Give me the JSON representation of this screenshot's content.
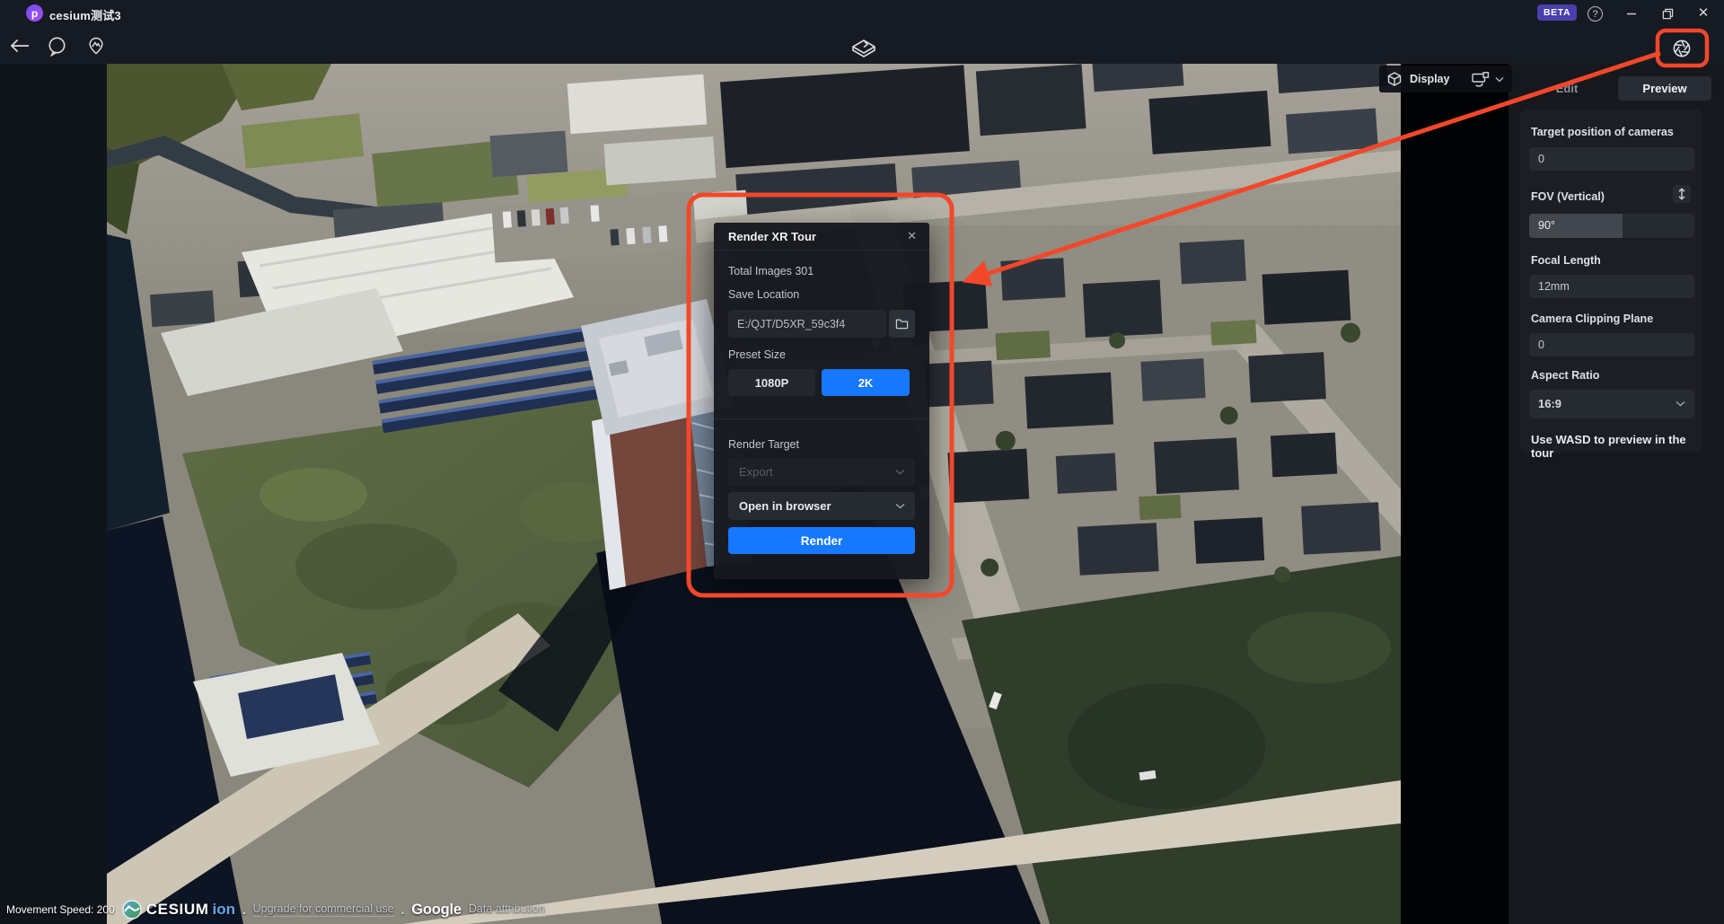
{
  "window": {
    "title": "cesium测试3",
    "logo_letter": "p",
    "beta_label": "BETA"
  },
  "toolbar": {
    "icons": [
      "back-arrow",
      "chat-bubble",
      "poi-pin",
      "scene-cube",
      "aperture-settings"
    ]
  },
  "display_control": {
    "label": "Display"
  },
  "status_bar": {
    "movement_speed": "Movement Speed: 200",
    "cesium_brand": "CESIUM",
    "ion_brand": "ion",
    "separator": ".",
    "upgrade_link": "Upgrade for commercial use",
    "google_brand": "Google",
    "attribution_link": "Data attribution"
  },
  "modal": {
    "title": "Render XR Tour",
    "total_images_label": "Total Images 301",
    "save_location_label": "Save Location",
    "save_path": "E:/QJT/D5XR_59c3f4",
    "preset_size_label": "Preset Size",
    "presets": [
      {
        "label": "1080P",
        "selected": false
      },
      {
        "label": "2K",
        "selected": true
      }
    ],
    "render_target_label": "Render Target",
    "export_placeholder": "Export",
    "open_mode": "Open in browser",
    "render_button_label": "Render"
  },
  "sidebar": {
    "tabs": [
      {
        "label": "Edit",
        "active": false
      },
      {
        "label": "Preview",
        "active": true
      }
    ],
    "fields": [
      {
        "label": "Target position of cameras",
        "value": "0"
      },
      {
        "label": "FOV (Vertical)",
        "value": "90°"
      },
      {
        "label": "Focal Length",
        "value": "12mm"
      },
      {
        "label": "Camera Clipping Plane",
        "value": "0"
      },
      {
        "label": "Aspect Ratio",
        "value": "16:9"
      }
    ],
    "hint": "Use WASD to preview in the tour"
  },
  "colors": {
    "accent_blue": "#1677ff",
    "annotation_red": "#f3472a",
    "beta_purple": "#4b3fae"
  }
}
